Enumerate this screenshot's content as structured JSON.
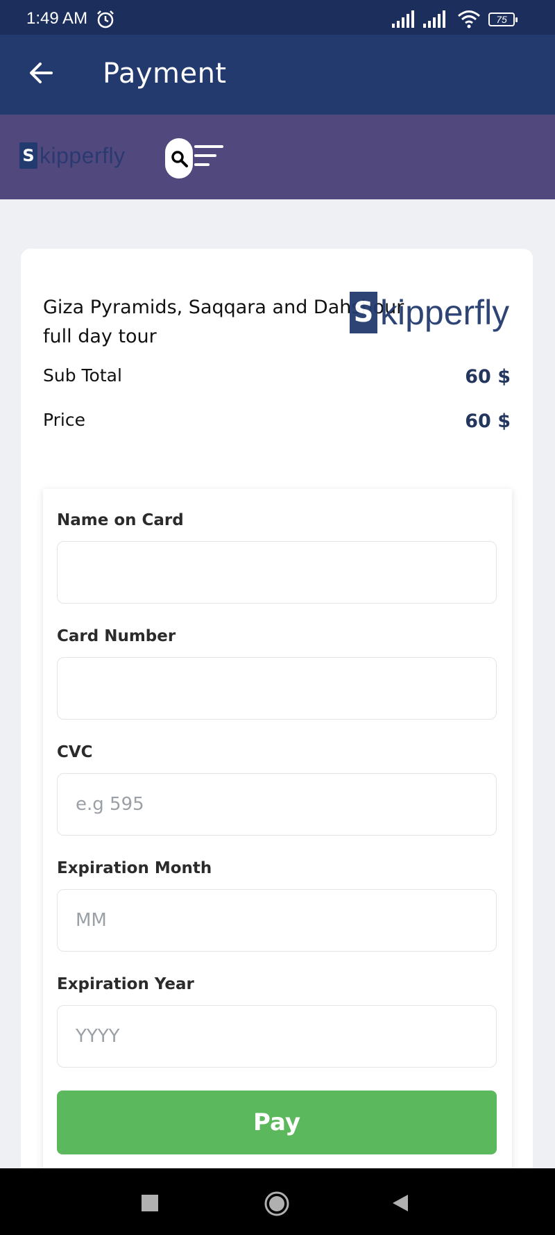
{
  "status_bar": {
    "time": "1:49 AM",
    "battery": "75"
  },
  "app_bar": {
    "title": "Payment"
  },
  "header": {
    "logo_mark": "S",
    "logo_text": "kipperfly"
  },
  "order": {
    "tour_title": "Giza Pyramids, Saqqara and Dahshour full day tour",
    "watermark_mark": "S",
    "watermark_text": "kipperfly",
    "sub_total_label": "Sub Total",
    "sub_total_value": "60 $",
    "price_label": "Price",
    "price_value": "60 $"
  },
  "form": {
    "name_label": "Name on Card",
    "name_value": "",
    "card_label": "Card Number",
    "card_value": "",
    "cvc_label": "CVC",
    "cvc_placeholder": "e.g 595",
    "month_label": "Expiration Month",
    "month_placeholder": "MM",
    "year_label": "Expiration Year",
    "year_placeholder": "YYYY",
    "pay_label": "Pay"
  },
  "colors": {
    "app_bar": "#233a6e",
    "header": "#51497e",
    "pay_button": "#5cb85c",
    "price_text": "#23365e"
  },
  "icons": [
    "alarm-icon",
    "signal-icon",
    "wifi-icon",
    "back-arrow-icon",
    "search-icon",
    "menu-icon",
    "nav-recents-icon",
    "nav-home-icon",
    "nav-back-icon"
  ]
}
